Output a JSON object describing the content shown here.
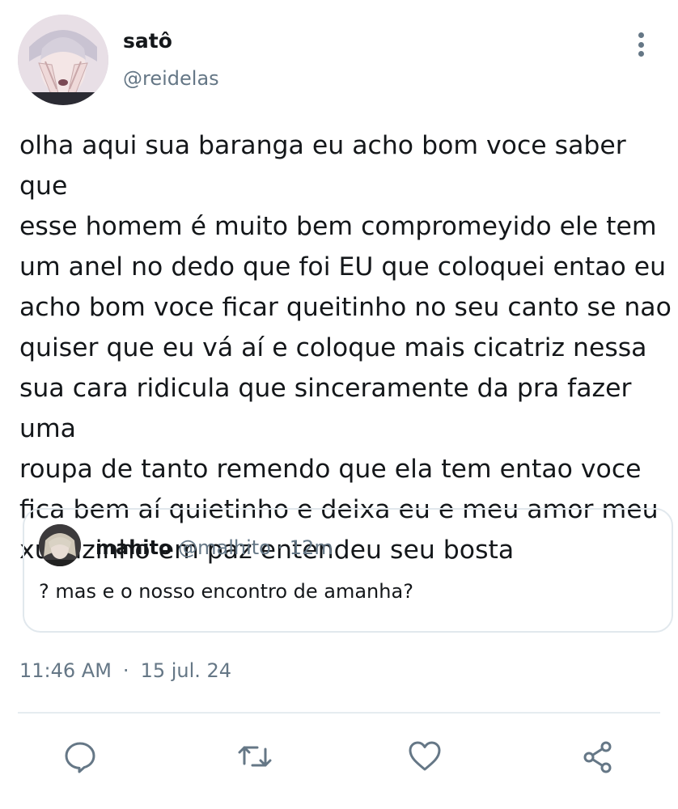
{
  "author": {
    "display_name": "satô",
    "handle": "@reidelas",
    "avatar_icon": "profile-avatar"
  },
  "menu_icon": "more-vertical-icon",
  "tweet": {
    "text": "olha aqui sua baranga eu acho bom voce saber que\nesse homem é muito bem compromeyido ele tem\num anel no dedo que foi EU que coloquei entao eu\nacho bom voce ficar queitinho no seu canto se nao\nquiser que eu vá aí e coloque mais cicatriz nessa\nsua cara ridicula que sinceramente da pra fazer uma\nroupa de tanto remendo que ela tem entao voce\nfica bem aí quietinho e deixa eu e meu amor meu\nxuxuzinho em paz entendeu seu bosta",
    "time": "11:46 AM",
    "separator": "·",
    "date": "15 jul. 24"
  },
  "quoted_tweet": {
    "display_name": "mahito",
    "handle": "@malhito",
    "separator": "·",
    "age": "12m",
    "text": "? mas e o nosso encontro de amanha?"
  },
  "actions": [
    {
      "name": "reply",
      "icon": "reply-bubble-icon"
    },
    {
      "name": "retweet",
      "icon": "retweet-arrows-icon"
    },
    {
      "name": "like",
      "icon": "heart-icon"
    },
    {
      "name": "share",
      "icon": "share-nodes-icon"
    }
  ],
  "colors": {
    "text_primary": "#14171a",
    "text_secondary": "#657786",
    "border": "#e1e8ed"
  }
}
